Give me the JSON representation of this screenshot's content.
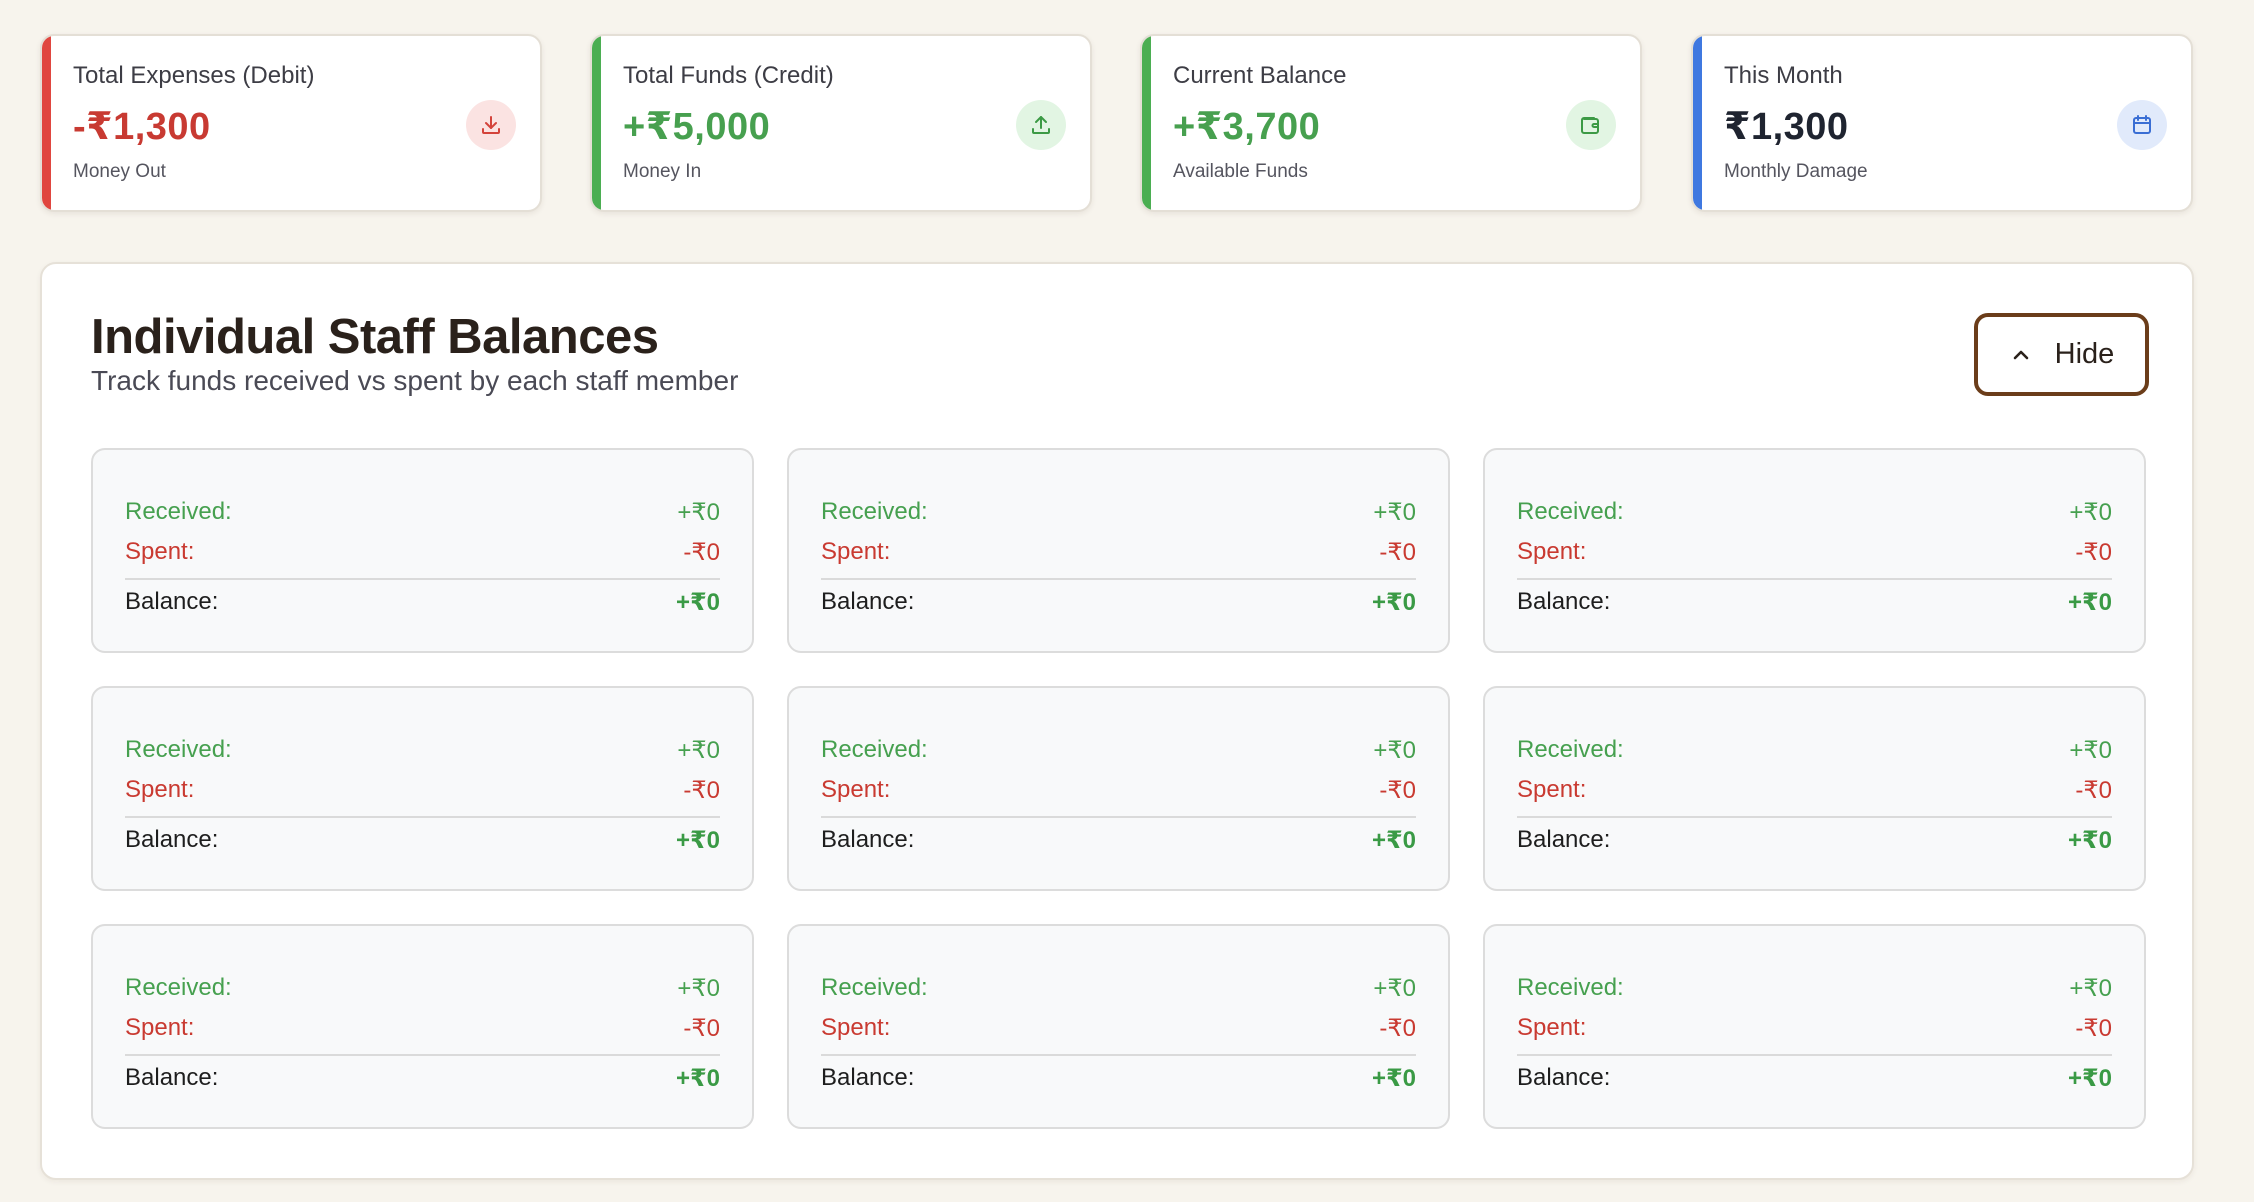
{
  "stats": [
    {
      "label": "Total Expenses (Debit)",
      "value": "-₹1,300",
      "sub": "Money Out",
      "icon": "download-icon",
      "accent": "#e0463f",
      "value_color": "#c83a32",
      "icon_bg": "#fbe3e2",
      "icon_color": "#d4433b"
    },
    {
      "label": "Total Funds (Credit)",
      "value": "+₹5,000",
      "sub": "Money In",
      "icon": "upload-icon",
      "accent": "#4bae52",
      "value_color": "#47a04f",
      "icon_bg": "#e2f5e3",
      "icon_color": "#3c9a45"
    },
    {
      "label": "Current Balance",
      "value": "+₹3,700",
      "sub": "Available Funds",
      "icon": "wallet-icon",
      "accent": "#4bae52",
      "value_color": "#47a04f",
      "icon_bg": "#e2f5e3",
      "icon_color": "#3c9a45"
    },
    {
      "label": "This Month",
      "value": "₹1,300",
      "sub": "Monthly Damage",
      "icon": "calendar-icon",
      "accent": "#3f78e0",
      "value_color": "#1f2430",
      "icon_bg": "#e1eafb",
      "icon_color": "#3a6ed4"
    }
  ],
  "panel": {
    "title": "Individual Staff Balances",
    "subtitle": "Track funds received vs spent by each staff member",
    "hide_label": "Hide"
  },
  "staff_cards": [
    {
      "received_label": "Received:",
      "received": "+₹0",
      "spent_label": "Spent:",
      "spent": "-₹0",
      "balance_label": "Balance:",
      "balance": "+₹0"
    },
    {
      "received_label": "Received:",
      "received": "+₹0",
      "spent_label": "Spent:",
      "spent": "-₹0",
      "balance_label": "Balance:",
      "balance": "+₹0"
    },
    {
      "received_label": "Received:",
      "received": "+₹0",
      "spent_label": "Spent:",
      "spent": "-₹0",
      "balance_label": "Balance:",
      "balance": "+₹0"
    },
    {
      "received_label": "Received:",
      "received": "+₹0",
      "spent_label": "Spent:",
      "spent": "-₹0",
      "balance_label": "Balance:",
      "balance": "+₹0"
    },
    {
      "received_label": "Received:",
      "received": "+₹0",
      "spent_label": "Spent:",
      "spent": "-₹0",
      "balance_label": "Balance:",
      "balance": "+₹0"
    },
    {
      "received_label": "Received:",
      "received": "+₹0",
      "spent_label": "Spent:",
      "spent": "-₹0",
      "balance_label": "Balance:",
      "balance": "+₹0"
    },
    {
      "received_label": "Received:",
      "received": "+₹0",
      "spent_label": "Spent:",
      "spent": "-₹0",
      "balance_label": "Balance:",
      "balance": "+₹0"
    },
    {
      "received_label": "Received:",
      "received": "+₹0",
      "spent_label": "Spent:",
      "spent": "-₹0",
      "balance_label": "Balance:",
      "balance": "+₹0"
    },
    {
      "received_label": "Received:",
      "received": "+₹0",
      "spent_label": "Spent:",
      "spent": "-₹0",
      "balance_label": "Balance:",
      "balance": "+₹0"
    }
  ]
}
